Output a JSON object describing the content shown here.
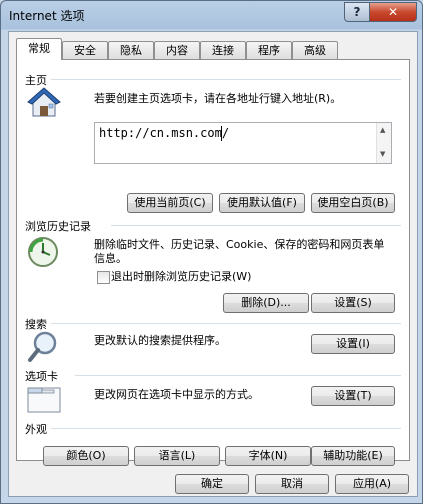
{
  "window": {
    "title": "Internet 选项",
    "help_label": "?",
    "close_label": "✕"
  },
  "tabs": [
    {
      "label": "常规"
    },
    {
      "label": "安全"
    },
    {
      "label": "隐私"
    },
    {
      "label": "内容"
    },
    {
      "label": "连接"
    },
    {
      "label": "程序"
    },
    {
      "label": "高级"
    }
  ],
  "homepage": {
    "title": "主页",
    "description": "若要创建主页选项卡，请在各地址行键入地址(R)。",
    "url": "http://cn.msn.com/",
    "use_current": "使用当前页(C)",
    "use_default": "使用默认值(F)",
    "use_blank": "使用空白页(B)"
  },
  "history": {
    "title": "浏览历史记录",
    "description": "删除临时文件、历史记录、Cookie、保存的密码和网页表单信息。",
    "checkbox_label": "退出时删除浏览历史记录(W)",
    "delete": "删除(D)...",
    "settings": "设置(S)"
  },
  "search": {
    "title": "搜索",
    "description": "更改默认的搜索提供程序。",
    "settings": "设置(I)"
  },
  "tabs_group": {
    "title": "选项卡",
    "description": "更改网页在选项卡中显示的方式。",
    "settings": "设置(T)"
  },
  "appearance": {
    "title": "外观",
    "colors": "颜色(O)",
    "languages": "语言(L)",
    "fonts": "字体(N)",
    "accessibility": "辅助功能(E)"
  },
  "footer": {
    "ok": "确定",
    "cancel": "取消",
    "apply": "应用(A)"
  }
}
